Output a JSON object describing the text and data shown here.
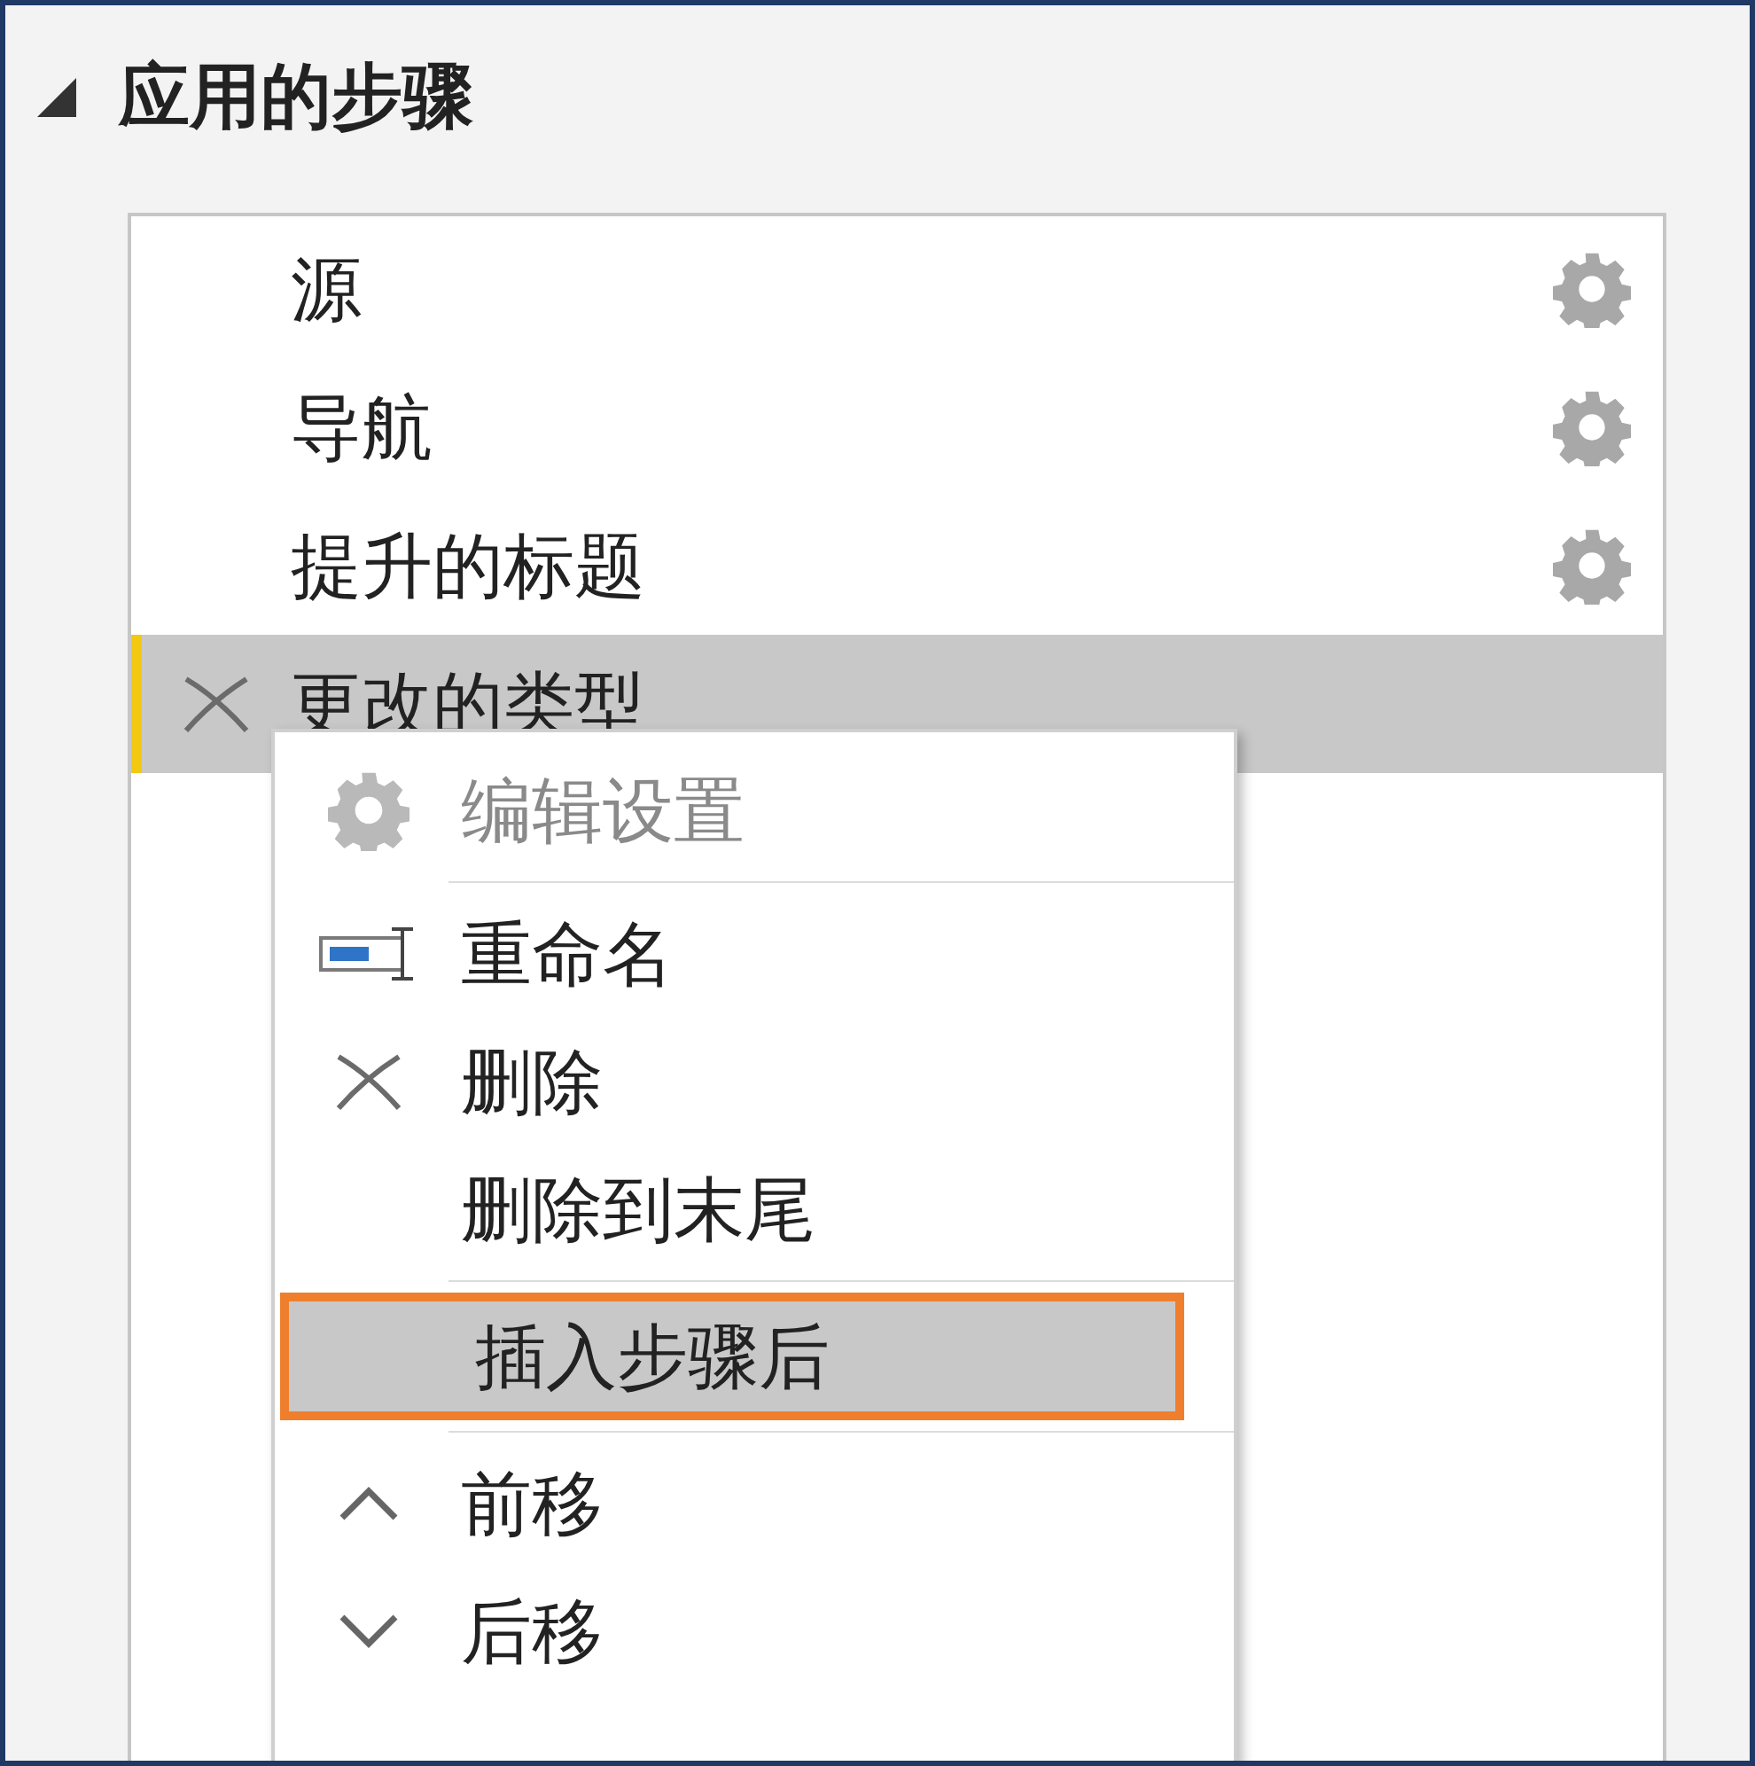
{
  "panel": {
    "title": "应用的步骤",
    "expanded": true
  },
  "steps": [
    {
      "name": "源",
      "has_settings": true,
      "selected": false
    },
    {
      "name": "导航",
      "has_settings": true,
      "selected": false
    },
    {
      "name": "提升的标题",
      "has_settings": true,
      "selected": false
    },
    {
      "name": "更改的类型",
      "has_settings": false,
      "selected": true
    }
  ],
  "context_menu": {
    "items": [
      {
        "kind": "item",
        "label": "编辑设置",
        "disabled": true,
        "highlighted": false
      },
      {
        "kind": "separator"
      },
      {
        "kind": "item",
        "label": "重命名",
        "disabled": false,
        "highlighted": false
      },
      {
        "kind": "item",
        "label": "删除",
        "disabled": false,
        "highlighted": false
      },
      {
        "kind": "item",
        "label": "删除到末尾",
        "disabled": false,
        "highlighted": false
      },
      {
        "kind": "separator"
      },
      {
        "kind": "item",
        "label": "插入步骤后",
        "disabled": false,
        "highlighted": true
      },
      {
        "kind": "separator"
      },
      {
        "kind": "item",
        "label": "前移",
        "disabled": false,
        "highlighted": false
      },
      {
        "kind": "item",
        "label": "后移",
        "disabled": false,
        "highlighted": false
      }
    ]
  }
}
